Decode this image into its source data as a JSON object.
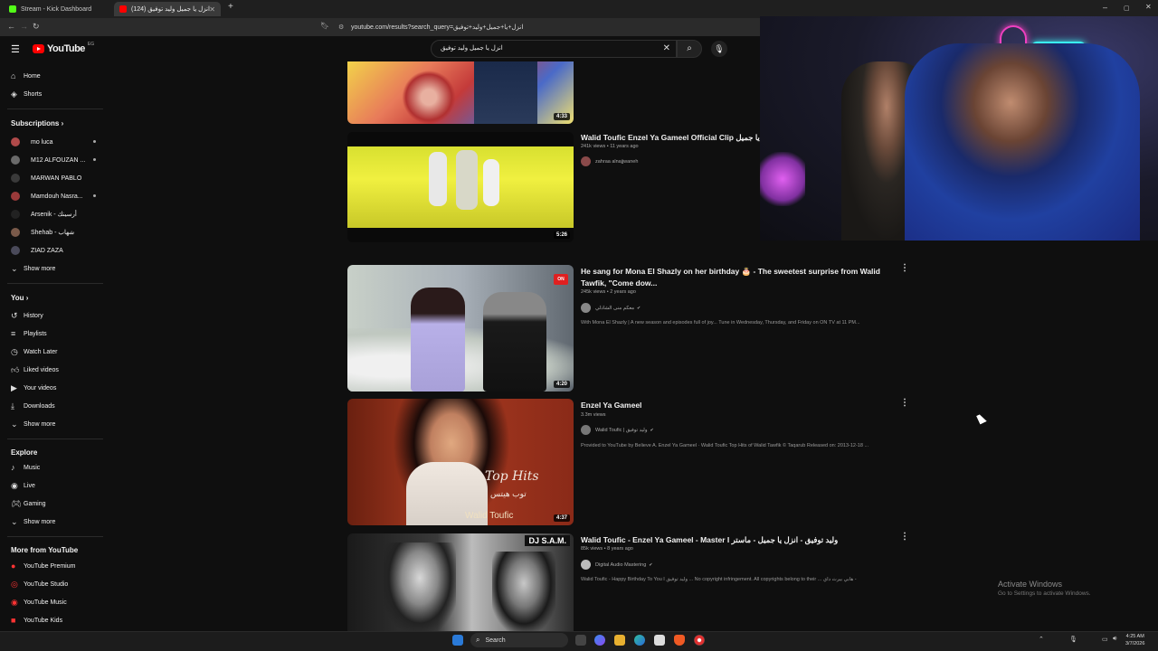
{
  "browser": {
    "tabs": [
      {
        "label": "Stream - Kick Dashboard",
        "active": false
      },
      {
        "label": "(124) انزل يا جميل وليد توفيق - ...",
        "active": true
      }
    ],
    "new_tab": "+",
    "url": "youtube.com/results?search_query=انزل+يا+جميل+وليد+توفيق",
    "window_controls": [
      "–",
      "▢",
      "✕"
    ]
  },
  "youtube": {
    "logo_text": "YouTube",
    "country": "EG",
    "search_value": "انزل يا جميل وليد توفيق",
    "sidebar": {
      "main": [
        {
          "label": "Home",
          "icon": "home-icon"
        },
        {
          "label": "Shorts",
          "icon": "shorts-icon"
        }
      ],
      "subscriptions_header": "Subscriptions  ›",
      "subscriptions": [
        {
          "label": "mo luca",
          "dot": true,
          "color": "#b04a4a"
        },
        {
          "label": "M12 ALFOUZAN ...",
          "dot": true,
          "color": "#6a6a6a"
        },
        {
          "label": "MARWAN PABLO",
          "dot": false,
          "color": "#3a3a3a"
        },
        {
          "label": "Mamdouh Nasra...",
          "dot": true,
          "color": "#9a3a3a"
        },
        {
          "label": "Arsenik - أرسينك",
          "dot": false,
          "color": "#222"
        },
        {
          "label": "Shehab - شهاب",
          "dot": false,
          "color": "#7a5a4a"
        },
        {
          "label": "ZIAD ZAZA",
          "dot": false,
          "color": "#4a4a5a"
        }
      ],
      "show_more": "Show more",
      "you_header": "You  ›",
      "you": [
        {
          "label": "History",
          "icon": "history-icon"
        },
        {
          "label": "Playlists",
          "icon": "playlists-icon"
        },
        {
          "label": "Watch Later",
          "icon": "watch-later-icon"
        },
        {
          "label": "Liked videos",
          "icon": "like-icon"
        },
        {
          "label": "Your videos",
          "icon": "your-videos-icon"
        },
        {
          "label": "Downloads",
          "icon": "download-icon"
        },
        {
          "label": "Show more",
          "icon": "chevron-down-icon"
        }
      ],
      "explore_header": "Explore",
      "explore": [
        {
          "label": "Music",
          "icon": "music-icon"
        },
        {
          "label": "Live",
          "icon": "live-icon"
        },
        {
          "label": "Gaming",
          "icon": "gaming-icon"
        },
        {
          "label": "Show more",
          "icon": "chevron-down-icon"
        }
      ],
      "more_header": "More from YouTube",
      "more": [
        {
          "label": "YouTube Premium"
        },
        {
          "label": "YouTube Studio"
        },
        {
          "label": "YouTube Music"
        },
        {
          "label": "YouTube Kids"
        }
      ]
    },
    "results": [
      {
        "duration": "4:33"
      },
      {
        "title": "Walid Toufic Enzel Ya Gameel Official Clip وليد توفيق - انزل يا جميل",
        "meta": "241k views • 11 years ago",
        "channel": "zahraa alnajjwaneh",
        "verified": false,
        "description": "",
        "duration": "5:26"
      },
      {
        "title": "He sang for Mona El Shazly on her birthday 🎂 - The sweetest surprise from Walid Tawfik, \"Come dow...",
        "meta": "245k views • 2 years ago",
        "channel": "معكم منى الشاذلي",
        "verified": true,
        "description": "With Mona El Shazly | A new season and episodes full of joy... Tune in Wednesday, Thursday, and Friday on ON TV at 11 PM...",
        "duration": "4:20"
      },
      {
        "title": "Enzel Ya Gameel",
        "meta": "3.3m views",
        "channel": "Walid Toufic | وليد توفيق",
        "verified": true,
        "description": "Provided to YouTube by Believe A. Enzel Ya Gameel · Walid Toufic Top Hits of Walid Tawfik © Taqarub Released on: 2013-12-18 ...",
        "duration": "4:37"
      },
      {
        "title": "Walid Toufic - Enzel Ya Gameel - Master I وليد توفيق - انزل يا جميل - ماستر",
        "meta": "85k views • 8 years ago",
        "channel": "Digital Audio Mastering",
        "verified": true,
        "description": "Walid Toufic - Happy Birthday To You I وليد توفيق ... No copyright infringement. All copyrights belong to their ... هابي بيرث داي -",
        "duration": ""
      }
    ],
    "thumb_text": {
      "top_hits": "Top Hits",
      "top_hits_ar": "توب هيتس",
      "walid": "Walid Toufic",
      "djsam": "DJ S.A.M.",
      "on_badge": "ON"
    }
  },
  "taskbar": {
    "search_label": "Search",
    "time": "4:25 AM",
    "date": "3/7/2026"
  },
  "watermark": {
    "title": "Activate Windows",
    "subtitle": "Go to Settings to activate Windows."
  }
}
